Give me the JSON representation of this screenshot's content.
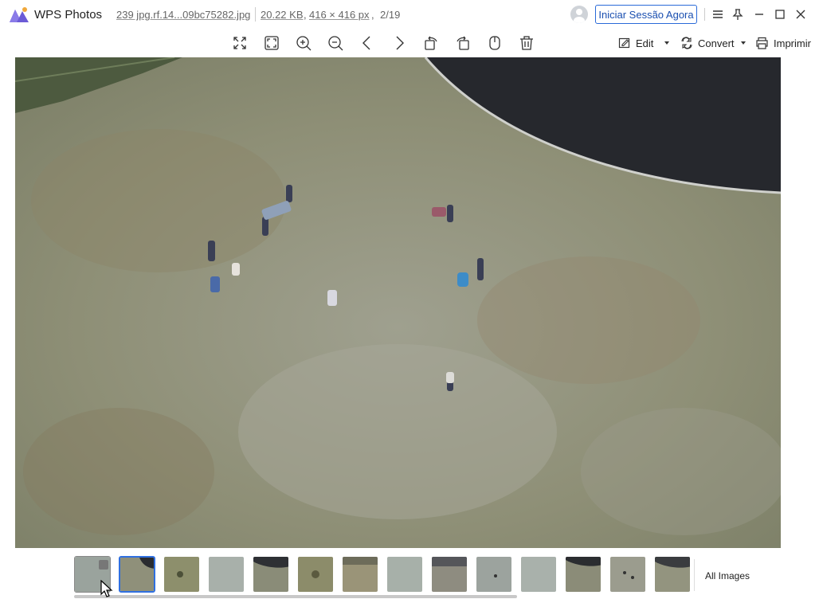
{
  "app": {
    "name": "WPS Photos",
    "file_name": "239 jpg.rf.14...09bc75282.jpg",
    "file_size": "20.22 KB",
    "dimensions": "416 × 416 px",
    "position": "2/19",
    "login_label": "Iniciar Sessão Agora",
    "accent_color": "#2a6ad8"
  },
  "toolbar": {
    "tools": [
      "fullscreen-icon",
      "fit-window-icon",
      "zoom-in-icon",
      "zoom-out-icon",
      "previous-icon",
      "next-icon",
      "rotate-left-icon",
      "rotate-right-icon",
      "mirror-icon",
      "delete-icon"
    ],
    "edit_label": "Edit",
    "convert_label": "Convert",
    "print_label": "Imprimir"
  },
  "window_controls": [
    "menu-icon",
    "pin-icon",
    "minimize-icon",
    "maximize-icon",
    "close-icon"
  ],
  "thumbnails": {
    "count_visible": 14,
    "active_index": 1,
    "hover_index": 0,
    "all_images_label": "All Images"
  }
}
